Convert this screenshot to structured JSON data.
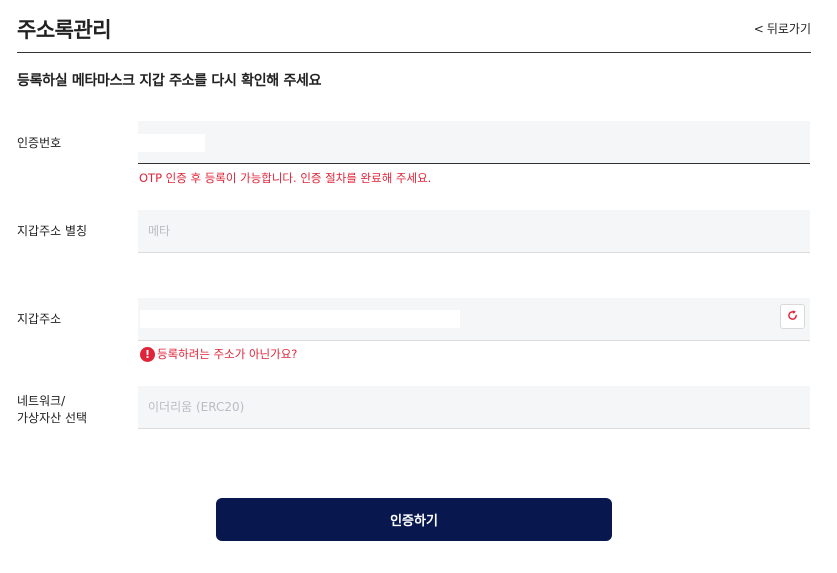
{
  "header": {
    "title": "주소록관리",
    "back_label": "뒤로가기"
  },
  "subtitle": "등록하실 메타마스크 지갑 주소를 다시 확인해 주세요",
  "form": {
    "otp": {
      "label": "인증번호",
      "value": "",
      "error": "OTP 인증 후 등록이 가능합니다. 인증 절차를 완료해 주세요."
    },
    "alias": {
      "label": "지갑주소 별칭",
      "placeholder": "메타"
    },
    "address": {
      "label": "지갑주소",
      "value": "",
      "warning": "등록하려는 주소가 아닌가요?",
      "warning_icon": "alert-circle-icon",
      "refresh_icon": "refresh-icon"
    },
    "network": {
      "label_line1": "네트워크/",
      "label_line2": "가상자산 선택",
      "placeholder": "이더리움 (ERC20)"
    }
  },
  "submit_label": "인증하기",
  "colors": {
    "primary": "#08184f",
    "error": "#e0243a",
    "field_bg": "#f5f6f8"
  }
}
